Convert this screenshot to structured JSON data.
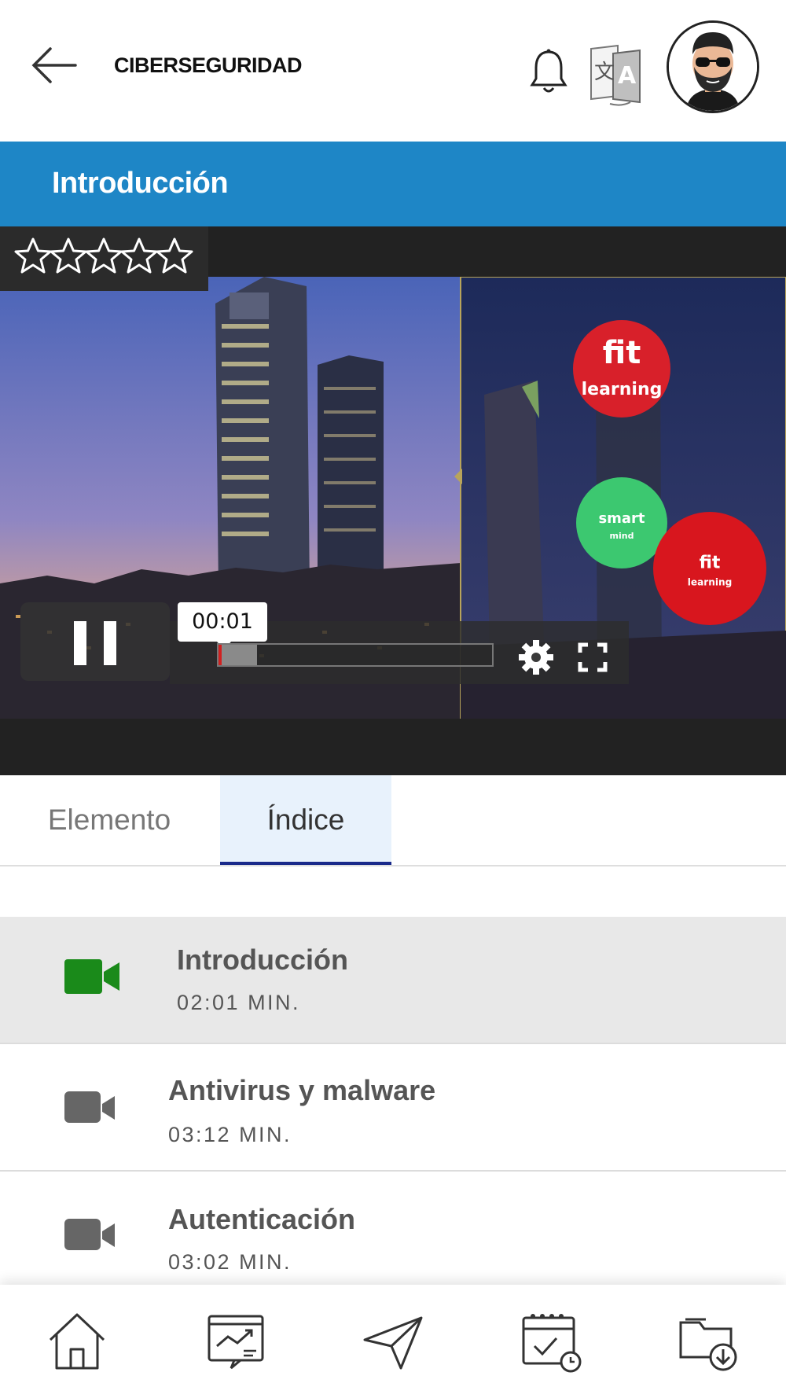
{
  "header": {
    "title": "CIBERSEGURIDAD",
    "icons": [
      "back-arrow-icon",
      "bell-icon",
      "translate-icon",
      "avatar"
    ]
  },
  "lesson_bar": {
    "title": "Introducción"
  },
  "video": {
    "rating": {
      "stars_filled": 0,
      "stars_total": 5
    },
    "time_tooltip": "00:01",
    "progress": 0.02,
    "logos": [
      "fit learning",
      "smart mind",
      "fit learning"
    ],
    "controls": [
      "pause-icon",
      "settings-gear-icon",
      "fullscreen-icon"
    ]
  },
  "tabs": [
    {
      "label": "Elemento",
      "active": false
    },
    {
      "label": "Índice",
      "active": true
    }
  ],
  "index_items": [
    {
      "title": "Introducción",
      "duration": "02:01 MIN.",
      "active": true,
      "icon": "video-camera-icon"
    },
    {
      "title": "Antivirus y malware",
      "duration": "03:12 MIN.",
      "active": false,
      "icon": "video-camera-icon"
    },
    {
      "title": "Autenticación",
      "duration": "03:02 MIN.",
      "active": false,
      "icon": "video-camera-icon"
    }
  ],
  "bottom_nav": [
    "home-icon",
    "dashboard-icon",
    "send-icon",
    "calendar-icon",
    "downloads-folder-icon"
  ],
  "colors": {
    "accent_blue": "#1e86c6",
    "active_camera": "#1a8a1a",
    "inactive_camera": "#666666",
    "active_row_bg": "#e8e8e8",
    "tab_active_bg": "#e8f2fc",
    "tab_underline": "#1a2a8a"
  }
}
